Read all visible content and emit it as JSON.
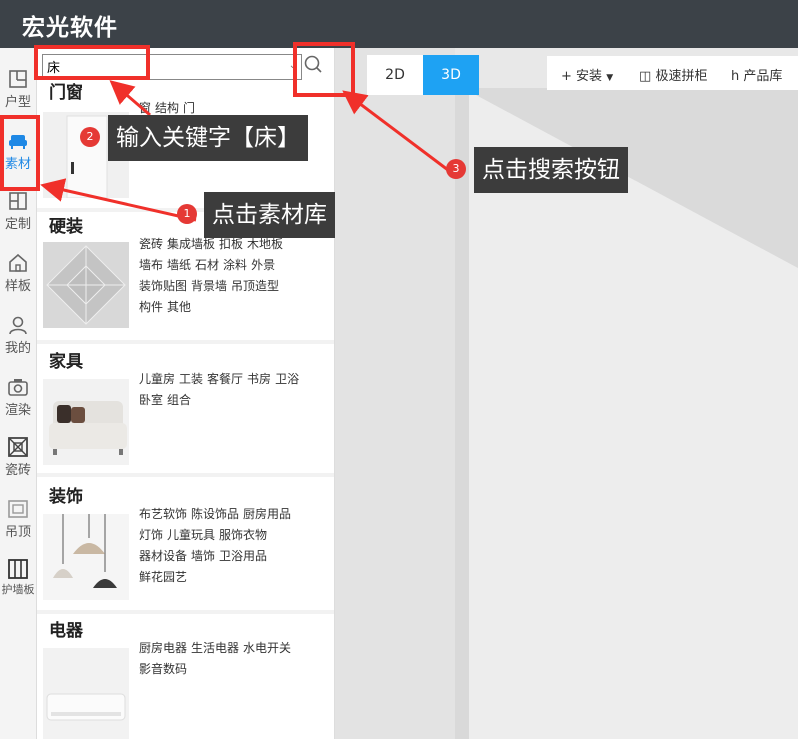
{
  "app": {
    "title": "宏光软件"
  },
  "sidebar": {
    "items": [
      {
        "label": "户型",
        "icon": "floorplan-icon"
      },
      {
        "label": "素材",
        "icon": "sofa-icon",
        "active": true
      },
      {
        "label": "定制",
        "icon": "custom-icon"
      },
      {
        "label": "样板",
        "icon": "house-icon"
      },
      {
        "label": "我的",
        "icon": "user-icon"
      },
      {
        "label": "渲染",
        "icon": "camera-icon"
      },
      {
        "label": "瓷砖",
        "icon": "tile-icon"
      },
      {
        "label": "吊顶",
        "icon": "ceiling-icon"
      },
      {
        "label": "护墙板",
        "icon": "wallpanel-icon"
      }
    ]
  },
  "search": {
    "value": "床",
    "button_icon": "search-icon"
  },
  "sections": [
    {
      "title": "门窗",
      "links": [
        "窗",
        "结构",
        "门"
      ]
    },
    {
      "title": "硬装",
      "links": [
        "瓷砖",
        "集成墙板",
        "扣板",
        "木地板",
        "墙布",
        "墙纸",
        "石材",
        "涂料",
        "外景",
        "装饰贴图",
        "背景墙",
        "吊顶造型",
        "构件",
        "其他"
      ]
    },
    {
      "title": "家具",
      "links": [
        "儿童房",
        "工装",
        "客餐厅",
        "书房",
        "卫浴",
        "卧室",
        "组合"
      ]
    },
    {
      "title": "装饰",
      "links": [
        "布艺软饰",
        "陈设饰品",
        "厨房用品",
        "灯饰",
        "儿童玩具",
        "服饰衣物",
        "器材设备",
        "墙饰",
        "卫浴用品",
        "鲜花园艺"
      ]
    },
    {
      "title": "电器",
      "links": [
        "厨房电器",
        "生活电器",
        "水电开关",
        "影音数码"
      ]
    }
  ],
  "view": {
    "mode_2d": "2D",
    "mode_3d": "3D",
    "active": "3D"
  },
  "toolbar": {
    "install": "安装",
    "quick_tile": "极速拼柜",
    "product_lib": "产品库"
  },
  "annotations": [
    {
      "number": "1",
      "text": "点击素材库"
    },
    {
      "number": "2",
      "text": "输入关键字【床】"
    },
    {
      "number": "3",
      "text": "点击搜索按钮"
    }
  ],
  "colors": {
    "header": "#3c4248",
    "accent": "#1ea2f3",
    "highlight": "#f0302a"
  }
}
